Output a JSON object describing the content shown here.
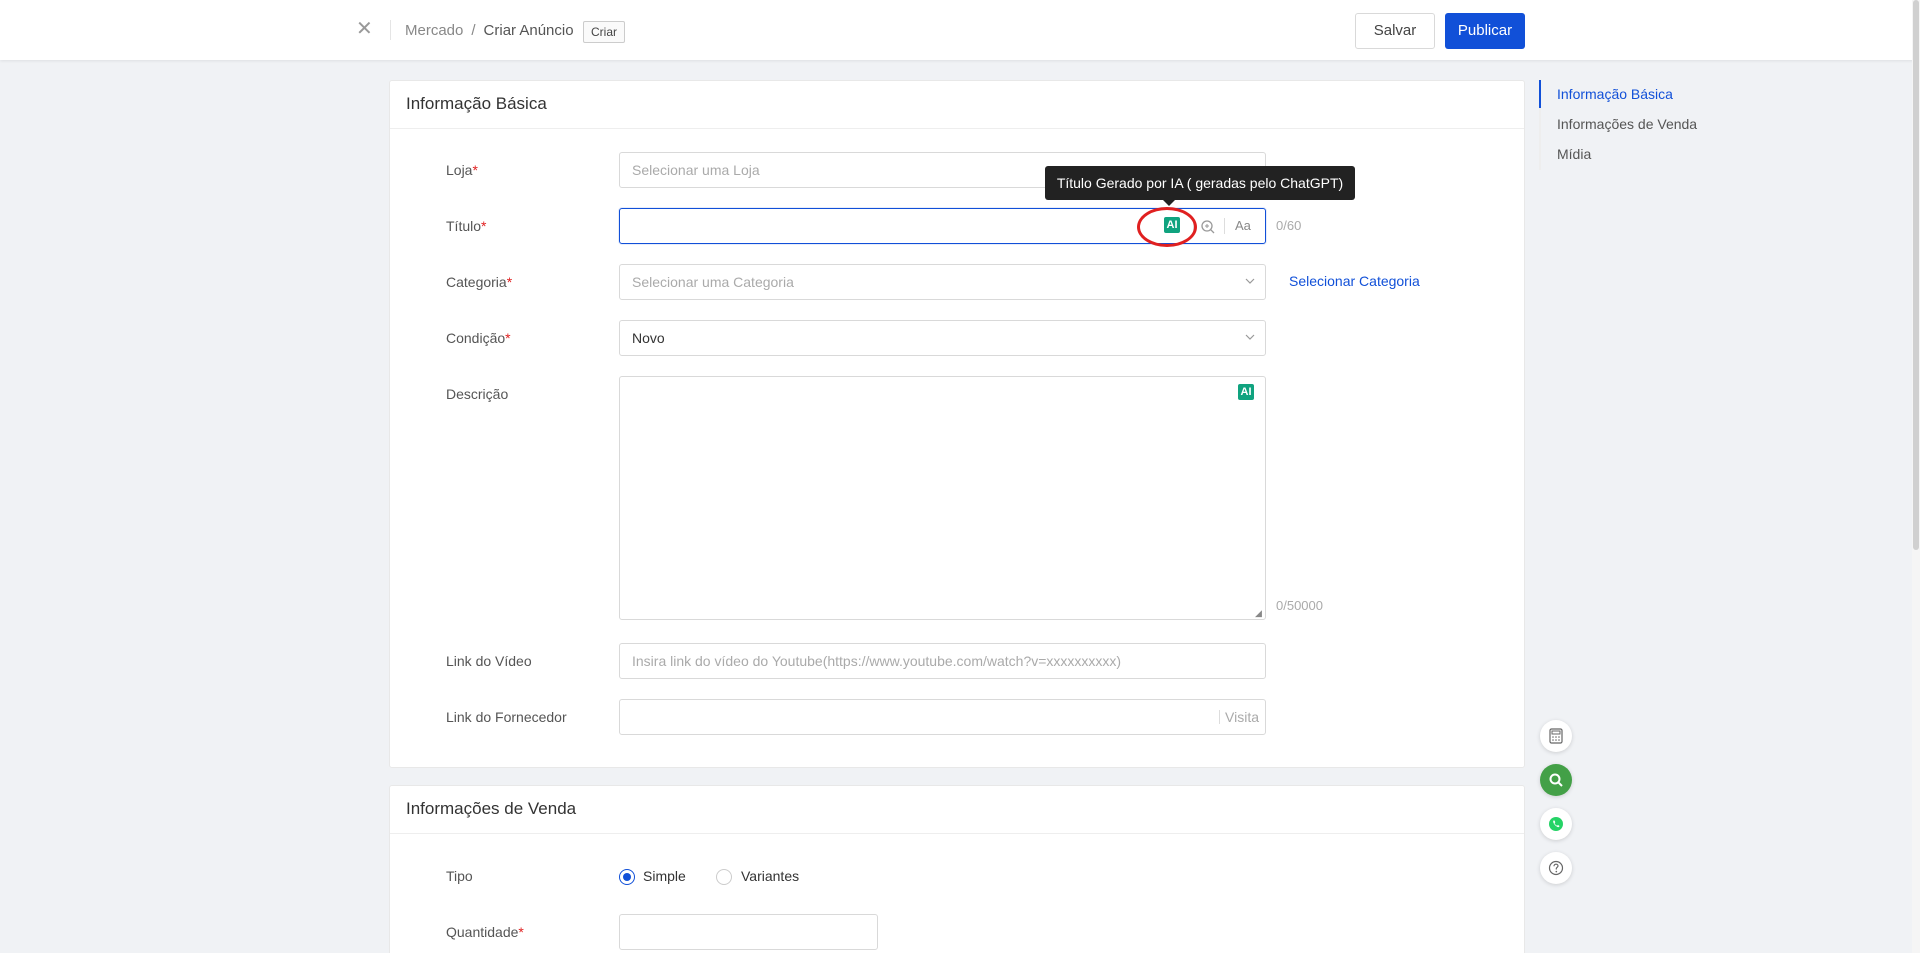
{
  "header": {
    "close_icon": "close-icon",
    "breadcrumb": [
      "Mercado",
      "Criar Anúncio"
    ],
    "breadcrumb_sep": "/",
    "badge": "Criar",
    "save_label": "Salvar",
    "publish_label": "Publicar"
  },
  "basic": {
    "title": "Informação Básica",
    "store_label": "Loja",
    "store_placeholder": "Selecionar uma Loja",
    "title_label": "Título",
    "title_counter": "0/60",
    "ai_label": "AI",
    "case_label": "Aa",
    "tooltip": "Título Gerado por IA ( geradas pelo ChatGPT)",
    "category_label": "Categoria",
    "category_placeholder": "Selecionar uma Categoria",
    "select_category_link": "Selecionar Categoria",
    "condition_label": "Condição",
    "condition_value": "Novo",
    "description_label": "Descrição",
    "description_counter": "0/50000",
    "video_label": "Link do Vídeo",
    "video_placeholder": "Insira link do vídeo do Youtube(https://www.youtube.com/watch?v=xxxxxxxxxx)",
    "supplier_label": "Link do Fornecedor",
    "supplier_visit": "Visita",
    "required_mark": "*"
  },
  "sale": {
    "title": "Informações de Venda",
    "type_label": "Tipo",
    "type_options": [
      "Simple",
      "Variantes"
    ],
    "type_selected": "Simple",
    "quantity_label": "Quantidade"
  },
  "anchor_nav": {
    "items": [
      "Informação Básica",
      "Informações de Venda",
      "Mídia"
    ],
    "active": "Informação Básica"
  },
  "colors": {
    "primary": "#1150d8",
    "ai_green": "#10a37f",
    "required": "#e02020",
    "highlight_circle": "#e02020"
  }
}
